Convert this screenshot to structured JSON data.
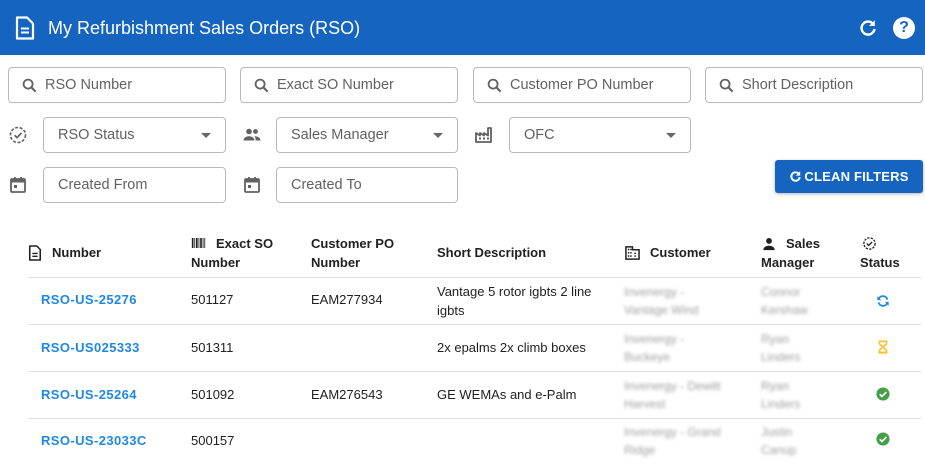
{
  "header": {
    "title": "My Refurbishment Sales Orders (RSO)"
  },
  "filters": {
    "rso_number": "RSO Number",
    "exact_so_number": "Exact SO Number",
    "customer_po_number": "Customer PO Number",
    "short_description": "Short Description",
    "rso_status": "RSO Status",
    "sales_manager": "Sales Manager",
    "ofc": "OFC",
    "created_from": "Created From",
    "created_to": "Created To",
    "clean_filters": "CLEAN FILTERS"
  },
  "table": {
    "headers": {
      "number": "Number",
      "exact_so_1": "Exact SO",
      "exact_so_2": "Number",
      "customer_po_1": "Customer PO",
      "customer_po_2": "Number",
      "short_description": "Short Description",
      "customer": "Customer",
      "sales_manager_1": "Sales",
      "sales_manager_2": "Manager",
      "status": "Status"
    },
    "rows": [
      {
        "number": "RSO-US-25276",
        "exact_so": "501127",
        "customer_po": "EAM277934",
        "desc_1": "Vantage 5 rotor igbts 2 line",
        "desc_2": "igbts",
        "customer_1": "Invenergy -",
        "customer_2": "Vantage Wind",
        "manager_1": "Connor",
        "manager_2": "Kershaw",
        "status_icon": "sync-icon"
      },
      {
        "number": "RSO-US025333",
        "exact_so": "501311",
        "customer_po": "",
        "desc_1": "2x epalms 2x climb boxes",
        "desc_2": "",
        "customer_1": "Invenergy -",
        "customer_2": "Buckeye",
        "manager_1": "Ryan",
        "manager_2": "Linders",
        "status_icon": "hourglass-icon"
      },
      {
        "number": "RSO-US-25264",
        "exact_so": "501092",
        "customer_po": "EAM276543",
        "desc_1": "GE WEMAs and e-Palm",
        "desc_2": "",
        "customer_1": "Invenergy - Dewitt",
        "customer_2": "Harvest",
        "manager_1": "Ryan",
        "manager_2": "Linders",
        "status_icon": "check-circle-icon"
      },
      {
        "number": "RSO-US-23033C",
        "exact_so": "500157",
        "customer_po": "",
        "desc_1": "",
        "desc_2": "",
        "customer_1": "Invenergy - Grand",
        "customer_2": "Ridge",
        "manager_1": "Justin",
        "manager_2": "Canup",
        "status_icon": "check-circle-icon"
      }
    ]
  },
  "colors": {
    "primary": "#1565c0",
    "link": "#1e88e5",
    "success": "#43a047",
    "pending": "#fbc02d",
    "sync": "#1e88e5"
  }
}
